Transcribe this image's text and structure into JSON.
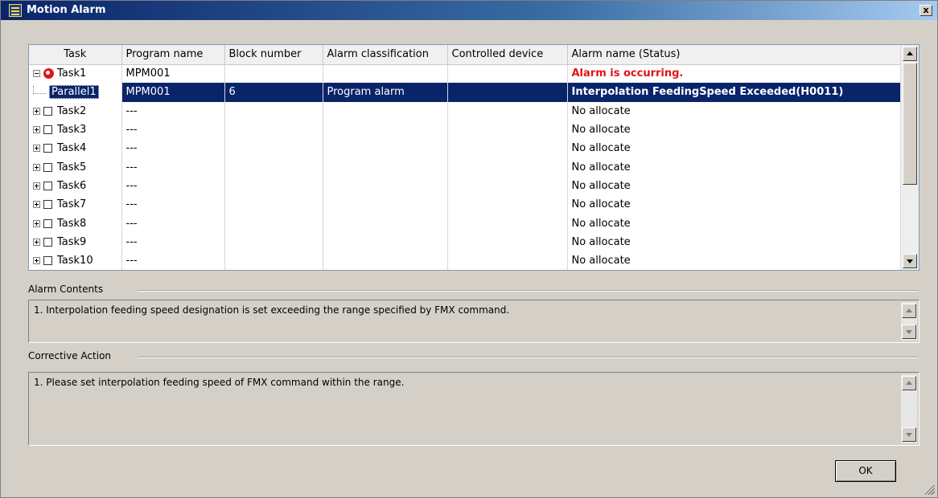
{
  "window": {
    "title": "Motion Alarm",
    "close_label": "x"
  },
  "grid": {
    "columns": [
      "Task",
      "Program name",
      "Block number",
      "Alarm classification",
      "Controlled device",
      "Alarm name (Status)"
    ],
    "rows": [
      {
        "task": "Task1",
        "program": "MPM001",
        "block": "",
        "classification": "",
        "device": "",
        "status": "Alarm is occurring."
      },
      {
        "task": "Parallel1",
        "program": "MPM001",
        "block": "6",
        "classification": "Program alarm",
        "device": "",
        "status": "Interpolation FeedingSpeed Exceeded(H0011)"
      },
      {
        "task": "Task2",
        "program": "---",
        "block": "",
        "classification": "",
        "device": "",
        "status": "No allocate"
      },
      {
        "task": "Task3",
        "program": "---",
        "block": "",
        "classification": "",
        "device": "",
        "status": "No allocate"
      },
      {
        "task": "Task4",
        "program": "---",
        "block": "",
        "classification": "",
        "device": "",
        "status": "No allocate"
      },
      {
        "task": "Task5",
        "program": "---",
        "block": "",
        "classification": "",
        "device": "",
        "status": "No allocate"
      },
      {
        "task": "Task6",
        "program": "---",
        "block": "",
        "classification": "",
        "device": "",
        "status": "No allocate"
      },
      {
        "task": "Task7",
        "program": "---",
        "block": "",
        "classification": "",
        "device": "",
        "status": "No allocate"
      },
      {
        "task": "Task8",
        "program": "---",
        "block": "",
        "classification": "",
        "device": "",
        "status": "No allocate"
      },
      {
        "task": "Task9",
        "program": "---",
        "block": "",
        "classification": "",
        "device": "",
        "status": "No allocate"
      },
      {
        "task": "Task10",
        "program": "---",
        "block": "",
        "classification": "",
        "device": "",
        "status": "No allocate"
      }
    ]
  },
  "alarm_contents": {
    "label": "Alarm Contents",
    "text": "1. Interpolation feeding speed designation is set exceeding the range specified by FMX command."
  },
  "corrective_action": {
    "label": "Corrective Action",
    "text": "1. Please set interpolation feeding speed of FMX command within the range."
  },
  "buttons": {
    "ok": "OK"
  },
  "colors": {
    "selection": "#0a246a",
    "alarm_text": "#e01515"
  }
}
